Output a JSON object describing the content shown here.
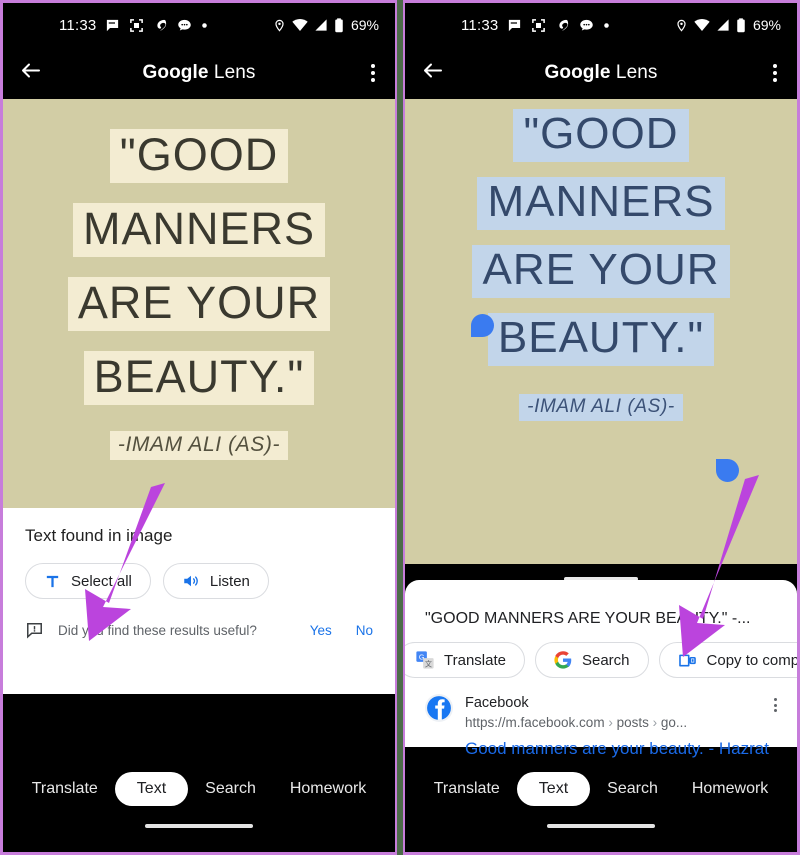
{
  "status_bar": {
    "time": "11:33",
    "battery_percent": "69%",
    "left_icons": [
      "message-icon",
      "screenshot-icon",
      "swirl-icon",
      "chat-bubble-icon",
      "dot-icon"
    ],
    "right_icons": [
      "location-icon",
      "wifi-icon",
      "signal-icon",
      "battery-icon"
    ]
  },
  "app_bar": {
    "title_bold": "Google",
    "title_light": " Lens",
    "back_icon": "arrow-back-icon",
    "overflow_icon": "more-vert-icon"
  },
  "quote_image": {
    "lines": [
      "\"GOOD",
      "MANNERS",
      "ARE YOUR",
      "BEAUTY.\""
    ],
    "attribution": "-IMAM ALI (AS)-",
    "background_color": "#d2cda5",
    "highlight_color_unselected": "#f3ecd2",
    "highlight_color_selected": "#c2d5ea",
    "selection_handle_color": "#3a7bf0"
  },
  "left_panel": {
    "found_label": "Text found in image",
    "chips": [
      {
        "label": "Select all",
        "icon": "text-select-icon"
      },
      {
        "label": "Listen",
        "icon": "volume-speaker-icon"
      }
    ],
    "feedback": {
      "icon": "feedback-icon",
      "question": "Did you find these results useful?",
      "yes": "Yes",
      "no": "No"
    }
  },
  "right_sheet": {
    "drag_handle": "sheet-drag-handle",
    "selected_text": "\"GOOD MANNERS ARE YOUR BEAUTY.\" -...",
    "chips": [
      {
        "label": "Translate",
        "icon": "google-translate-icon"
      },
      {
        "label": "Search",
        "icon": "google-g-icon"
      },
      {
        "label": "Copy to computer",
        "icon": "copy-to-computer-icon"
      }
    ],
    "result": {
      "favicon": "facebook-icon",
      "site": "Facebook",
      "url_base": "https://m.facebook.com",
      "url_crumb1": "posts",
      "url_crumb2": "go...",
      "link_title": "Good manners are your beauty. - Hazrat",
      "overflow_icon": "more-vert-icon"
    }
  },
  "bottom_nav": {
    "items": [
      "Translate",
      "Text",
      "Search",
      "Homework"
    ],
    "active": "Text",
    "home_indicator": "home-indicator"
  },
  "annotations": {
    "arrow_color": "#bb44dd",
    "arrow_left_target": "Select all",
    "arrow_right_target": "Copy to computer"
  }
}
